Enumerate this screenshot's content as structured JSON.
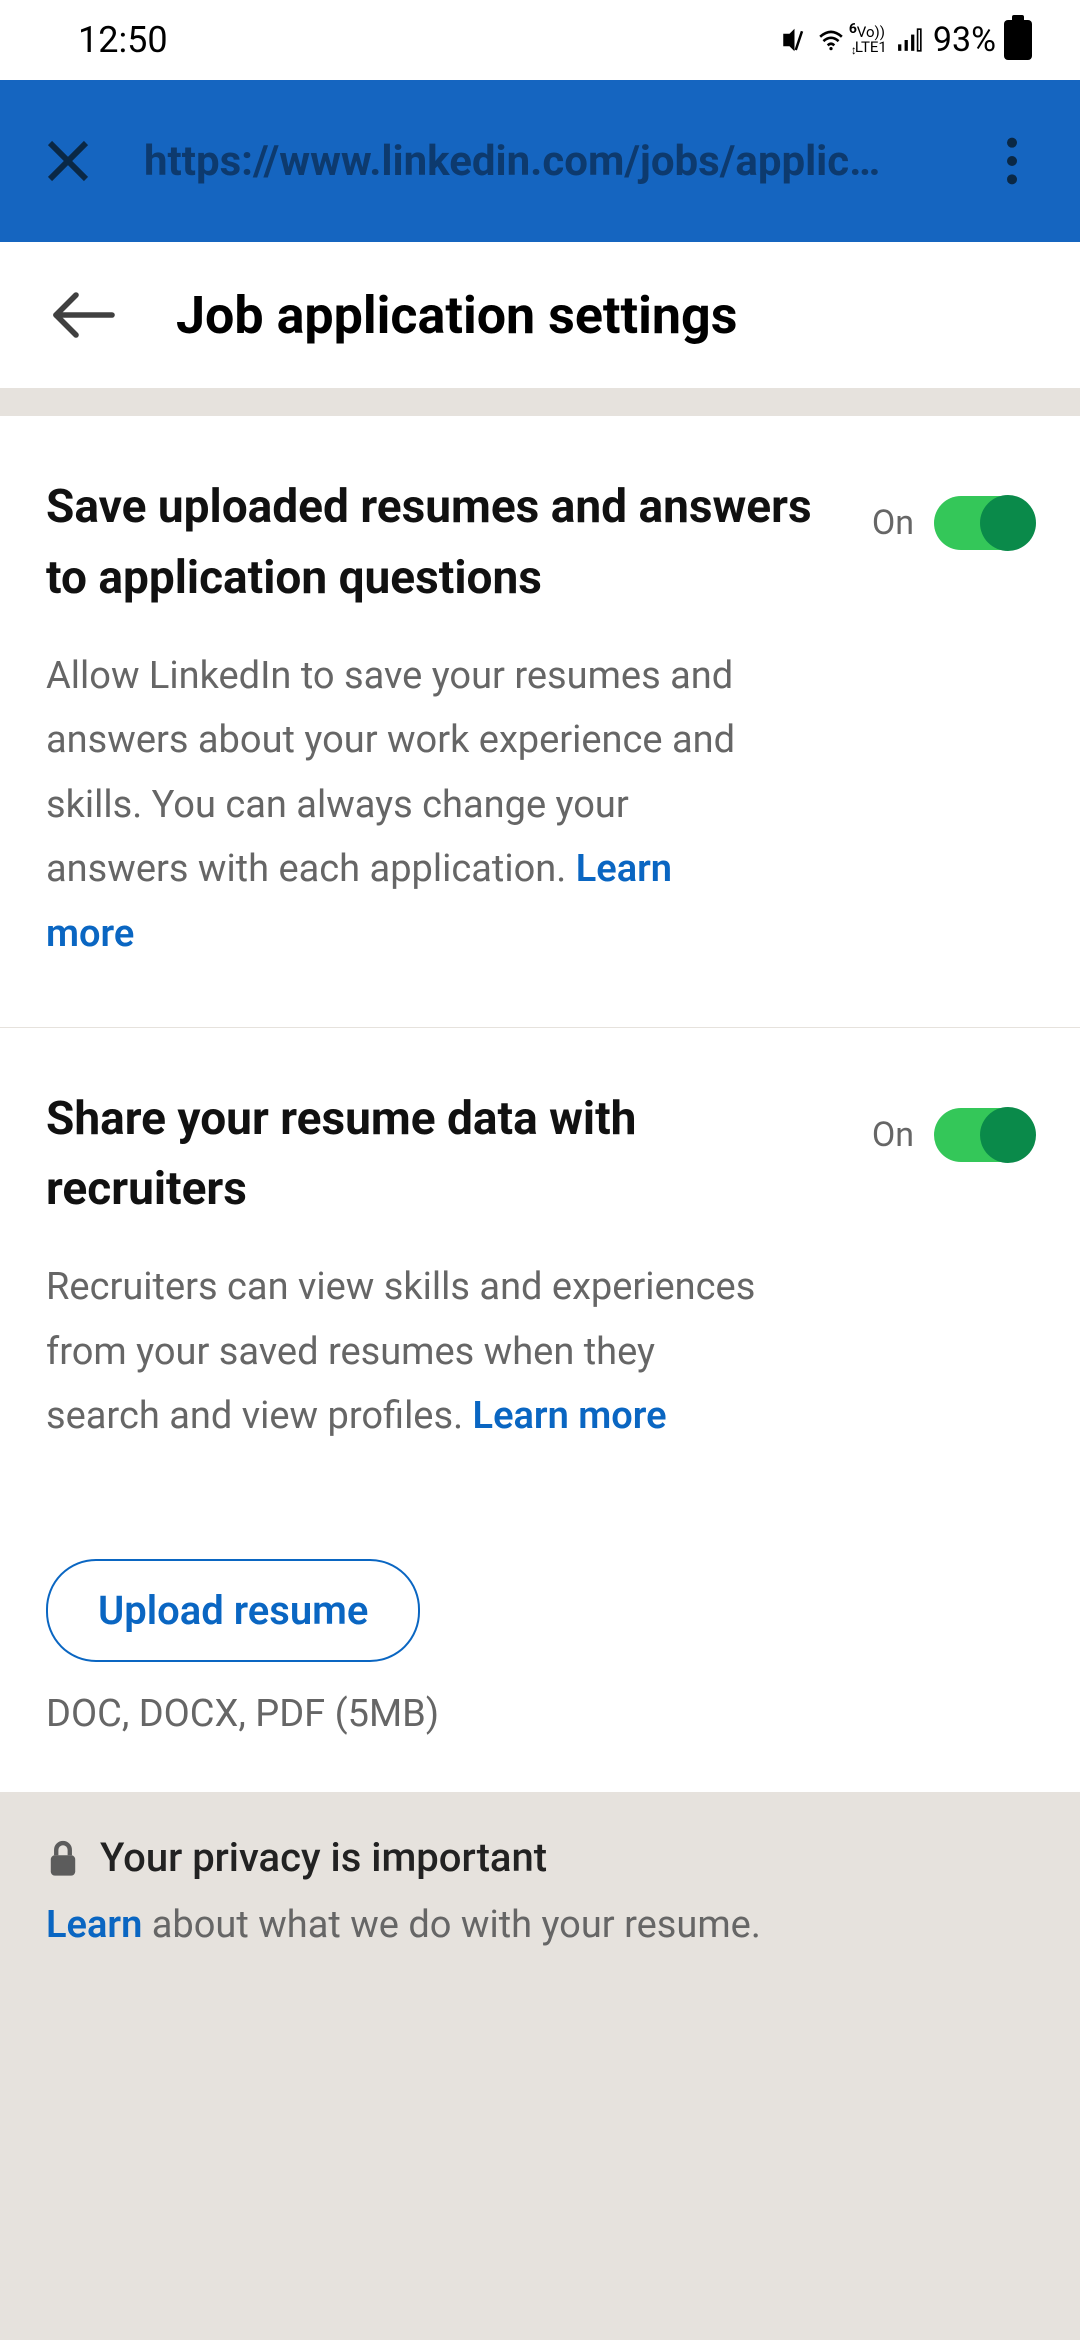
{
  "status": {
    "time": "12:50",
    "battery_pct": "93%",
    "net_top": "Vo))",
    "net_bottom": "LTE1",
    "wifi_num": "6"
  },
  "browser": {
    "url": "https://www.linkedin.com/jobs/applic…"
  },
  "header": {
    "title": "Job application settings"
  },
  "settings": [
    {
      "title": "Save uploaded resumes and answers to application questions",
      "state": "On",
      "desc_pre": "Allow LinkedIn to save your resumes and answers about your work experience and skills. You can always change your answers with each application. ",
      "learn": "Learn more"
    },
    {
      "title": "Share your resume data with recruiters",
      "state": "On",
      "desc_pre": "Recruiters can view skills and experiences from your saved resumes when they search and view profiles. ",
      "learn": "Learn more"
    }
  ],
  "upload": {
    "button": "Upload resume",
    "hint": "DOC, DOCX, PDF (5MB)"
  },
  "privacy": {
    "title": "Your privacy is important",
    "learn": "Learn",
    "rest": " about what we do with your resume."
  }
}
